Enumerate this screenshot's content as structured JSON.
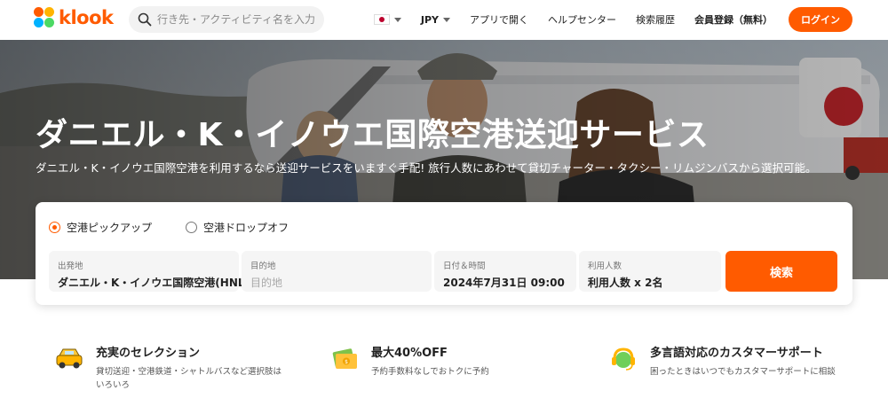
{
  "brand": {
    "name": "klook",
    "accent": "#ff5b00"
  },
  "search": {
    "placeholder": "行き先・アクティビティ名を入力",
    "icon": "search-icon"
  },
  "nav": {
    "language_flag": "japan-flag-icon",
    "currency": "JPY",
    "open_app": "アプリで開く",
    "help": "ヘルプセンター",
    "history": "検索履歴",
    "signup": "会員登録（無料）",
    "login": "ログイン"
  },
  "hero": {
    "title": "ダニエル・K・イノウエ国際空港送迎サービス",
    "subtitle": "ダニエル・K・イノウエ国際空港を利用するなら送迎サービスをいますぐ手配! 旅行人数にあわせて貸切チャーター・タクシー・リムジンバスから選択可能。"
  },
  "booking": {
    "options": [
      {
        "label": "空港ピックアップ",
        "selected": true
      },
      {
        "label": "空港ドロップオフ",
        "selected": false
      }
    ],
    "from": {
      "label": "出発地",
      "value": "ダニエル・K・イノウエ国際空港(HNL)"
    },
    "to": {
      "label": "目的地",
      "placeholder": "目的地"
    },
    "datetime": {
      "label": "日付＆時間",
      "value": "2024年7月31日 09:00"
    },
    "passengers": {
      "label": "利用人数",
      "value": "利用人数 x 2名"
    },
    "search_button": "検索"
  },
  "features": [
    {
      "icon": "car-icon",
      "title": "充実のセレクション",
      "text": "貸切送迎・空港鉄道・シャトルバスなど選択肢はいろいろ"
    },
    {
      "icon": "money-ticket-icon",
      "title": "最大40%OFF",
      "text": "予約手数料なしでおトクに予約"
    },
    {
      "icon": "headset-support-icon",
      "title": "多言語対応のカスタマーサポート",
      "text": "困ったときはいつでもカスタマーサポートに相談"
    }
  ]
}
